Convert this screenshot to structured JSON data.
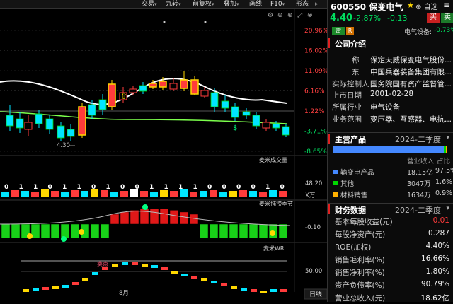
{
  "toolbar": {
    "items": [
      {
        "label": "交易",
        "caret": "▾"
      },
      {
        "label": "九转",
        "caret": "▾"
      },
      {
        "label": "前复权",
        "caret": "▾"
      },
      {
        "label": "叠加",
        "caret": "▾"
      },
      {
        "label": "画线",
        "caret": ""
      },
      {
        "label": "F10",
        "caret": "▾"
      },
      {
        "label": "形态",
        "caret": ""
      }
    ]
  },
  "chart": {
    "price_ticks": [
      "20.96%",
      "16.02%",
      "11.09%",
      "6.16%",
      "1.22%",
      "-3.71%",
      "-8.65%"
    ],
    "low_label": "4.30",
    "month_label": "8月",
    "volume_title": "麦米成交量",
    "volume_tick": "48.20",
    "volume_unit": "X万",
    "volume_digits": [
      "0",
      "1",
      "1",
      "0",
      "1",
      "1",
      "0",
      "1",
      "0",
      "0",
      "1",
      "1",
      "1",
      "1",
      "0",
      "0",
      "0",
      "0",
      "1",
      "0"
    ],
    "season_title": "麦米捕捞季节",
    "season_tick": "-0.10",
    "wr_title": "麦米WR",
    "wr_tick": "50.00",
    "wr_marker": "卖点",
    "period_tab": "日线",
    "colors": {
      "up": "#ff3b3b",
      "down": "#00e5ff",
      "ma": "#ffffff",
      "green": "#00d800",
      "yellow": "#ffd800"
    }
  },
  "stock": {
    "code_name": "600550 保变电气",
    "icons": {
      "favorite": "★",
      "add_watch": "⊕ 自选",
      "menu": "≡"
    },
    "price": "4.40",
    "change_pct": "-2.87%",
    "change": "-0.13",
    "buy_label": "买",
    "sell_label": "卖",
    "tag1": "雷",
    "tag2": "R",
    "sector_label": "电气设备:",
    "sector_change": "-0.73%"
  },
  "company": {
    "title": "公司介绍",
    "rows": [
      {
        "k": "称",
        "v": "保定天威保变电气股份..."
      },
      {
        "k": "东",
        "v": "中国兵器装备集团有限..."
      },
      {
        "k": "实际控制人",
        "v": "国务院国有资产监督管..."
      },
      {
        "k": "上市日期",
        "v": "2001-02-28"
      },
      {
        "k": "所属行业",
        "v": "电气设备"
      },
      {
        "k": "业务范围",
        "v": "变压器、互感器、电抗..."
      }
    ]
  },
  "products": {
    "title": "主营产品",
    "period": "2024-二季度",
    "headers": [
      "",
      "营业收入",
      "占比"
    ],
    "rows": [
      {
        "name": "输变电产品",
        "rev": "18.15亿",
        "pct": "97.5%",
        "color": "#4488ff",
        "share": 0.975
      },
      {
        "name": "其他",
        "rev": "3047万",
        "pct": "1.6%",
        "color": "#00d800",
        "share": 0.016
      },
      {
        "name": "材料销售",
        "rev": "1634万",
        "pct": "0.9%",
        "color": "#ffb000",
        "share": 0.009
      }
    ]
  },
  "finance": {
    "title": "财务数据",
    "period": "2024-二季度",
    "rows": [
      {
        "k": "基本每股收益(元)",
        "v": "0.01",
        "highlight": true
      },
      {
        "k": "每股净资产(元)",
        "v": "0.287"
      },
      {
        "k": "ROE(加权)",
        "v": "4.40%"
      },
      {
        "k": "销售毛利率(%)",
        "v": "16.66%"
      },
      {
        "k": "销售净利率(%)",
        "v": "1.80%"
      },
      {
        "k": "资产负债率(%)",
        "v": "90.79%"
      },
      {
        "k": "营业总收入(元)",
        "v": "18.62亿"
      }
    ]
  }
}
